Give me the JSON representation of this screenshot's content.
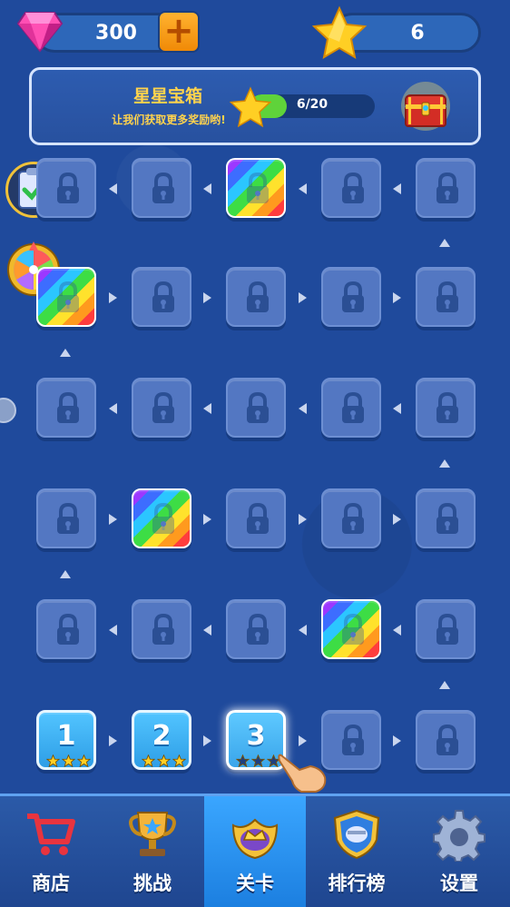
{
  "currency": {
    "gems": "300",
    "stars": "6"
  },
  "chest": {
    "title": "星星宝箱",
    "subtitle": "让我们获取更多奖励哟!",
    "progress_text": "6/20",
    "progress_fraction": 0.3
  },
  "levels": [
    {
      "number": "1",
      "stars": 3
    },
    {
      "number": "2",
      "stars": 3
    },
    {
      "number": "3",
      "stars": 0,
      "current": true
    }
  ],
  "tabs": [
    {
      "id": "shop",
      "label": "商店",
      "icon": "cart-icon"
    },
    {
      "id": "challenge",
      "label": "挑战",
      "icon": "trophy-icon"
    },
    {
      "id": "levels",
      "label": "关卡",
      "icon": "crown-badge-icon",
      "active": true
    },
    {
      "id": "leaderboard",
      "label": "排行榜",
      "icon": "shield-badge-icon"
    },
    {
      "id": "settings",
      "label": "设置",
      "icon": "gear-icon"
    }
  ],
  "colors": {
    "background": "#1f4a9c",
    "tile": "#5377c2",
    "level_tile": "#3aa5ea",
    "accent_orange": "#f08a07",
    "star_yellow": "#ffd34d",
    "active_tab": "#2a93f5"
  }
}
